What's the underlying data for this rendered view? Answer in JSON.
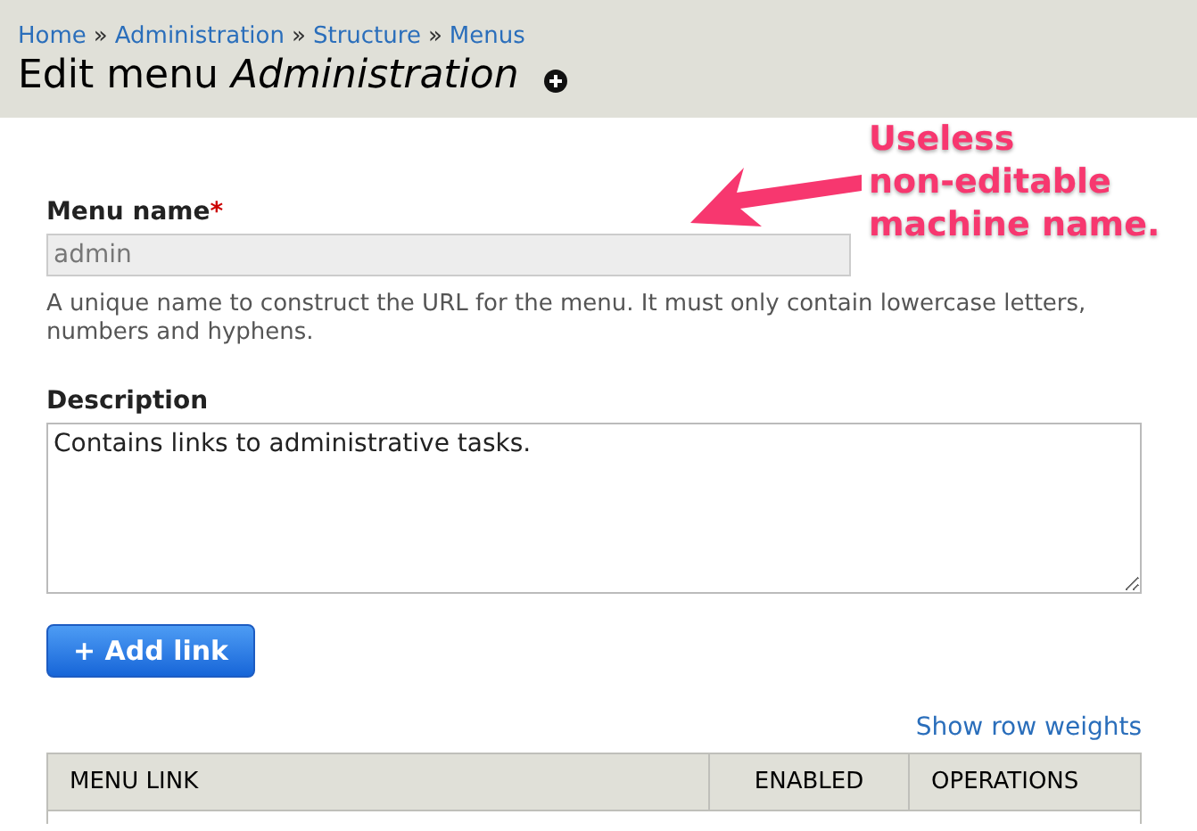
{
  "breadcrumb": [
    {
      "label": "Home"
    },
    {
      "label": "Administration"
    },
    {
      "label": "Structure"
    },
    {
      "label": "Menus"
    }
  ],
  "breadcrumb_separator": "»",
  "title": "Edit menu *Administration*",
  "menu_name": {
    "label": "Menu name",
    "required_mark": "*",
    "value": "admin",
    "disabled": true,
    "help": "A unique name to construct the URL for the menu. It must only contain lowercase letters, numbers and hyphens."
  },
  "description": {
    "label": "Description",
    "value": "Contains links to administrative tasks."
  },
  "add_link_button": "+ Add link",
  "show_row_weights": "Show row weights",
  "table": {
    "columns": [
      "MENU LINK",
      "ENABLED",
      "OPERATIONS"
    ]
  },
  "annotation": {
    "lines": [
      "Useless",
      "non-editable",
      "machine name."
    ]
  }
}
